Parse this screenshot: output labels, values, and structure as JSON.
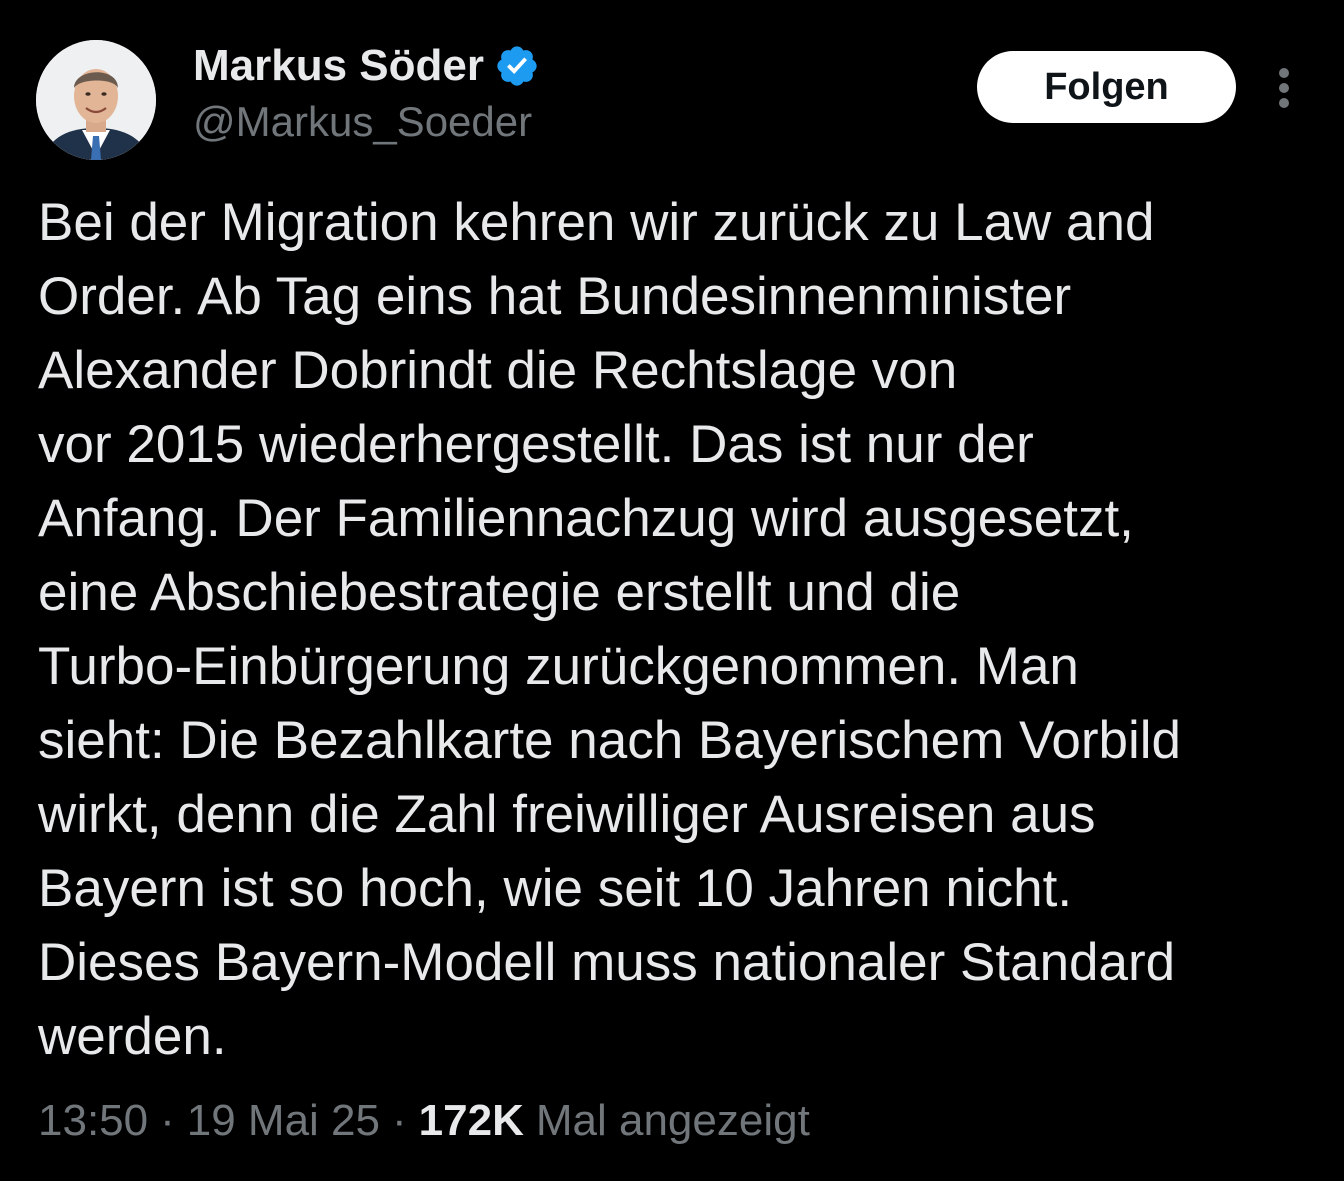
{
  "author": {
    "display_name": "Markus Söder",
    "handle": "@Markus_Soeder",
    "verified": true
  },
  "actions": {
    "follow_label": "Folgen"
  },
  "tweet": {
    "lines": [
      "Bei der Migration kehren wir zurück zu Law and",
      "Order. Ab Tag eins hat Bundesinnenminister",
      "Alexander Dobrindt die Rechtslage von",
      "vor 2015 wiederhergestellt. Das ist nur der",
      "Anfang. Der Familiennachzug wird ausgesetzt,",
      "eine Abschiebestrategie erstellt und die",
      "Turbo-Einbürgerung zurückgenommen. Man",
      "sieht: Die Bezahlkarte nach Bayerischem Vorbild",
      "wirkt, denn die Zahl freiwilliger Ausreisen aus",
      "Bayern ist so hoch, wie seit 10 Jahren nicht.",
      "Dieses Bayern-Modell muss nationaler Standard",
      "werden."
    ]
  },
  "meta": {
    "time": "13:50",
    "separator": "·",
    "date": "19 Mai 25",
    "views_count": "172K",
    "views_label": "Mal angezeigt"
  },
  "colors": {
    "background": "#000000",
    "text_primary": "#e7e9ea",
    "text_secondary": "#71767b",
    "verified_blue": "#1d9bf0",
    "follow_bg": "#ffffff"
  },
  "icons": {
    "verified": "verified-badge-icon",
    "more": "more-vertical-icon",
    "avatar": "profile-photo"
  }
}
